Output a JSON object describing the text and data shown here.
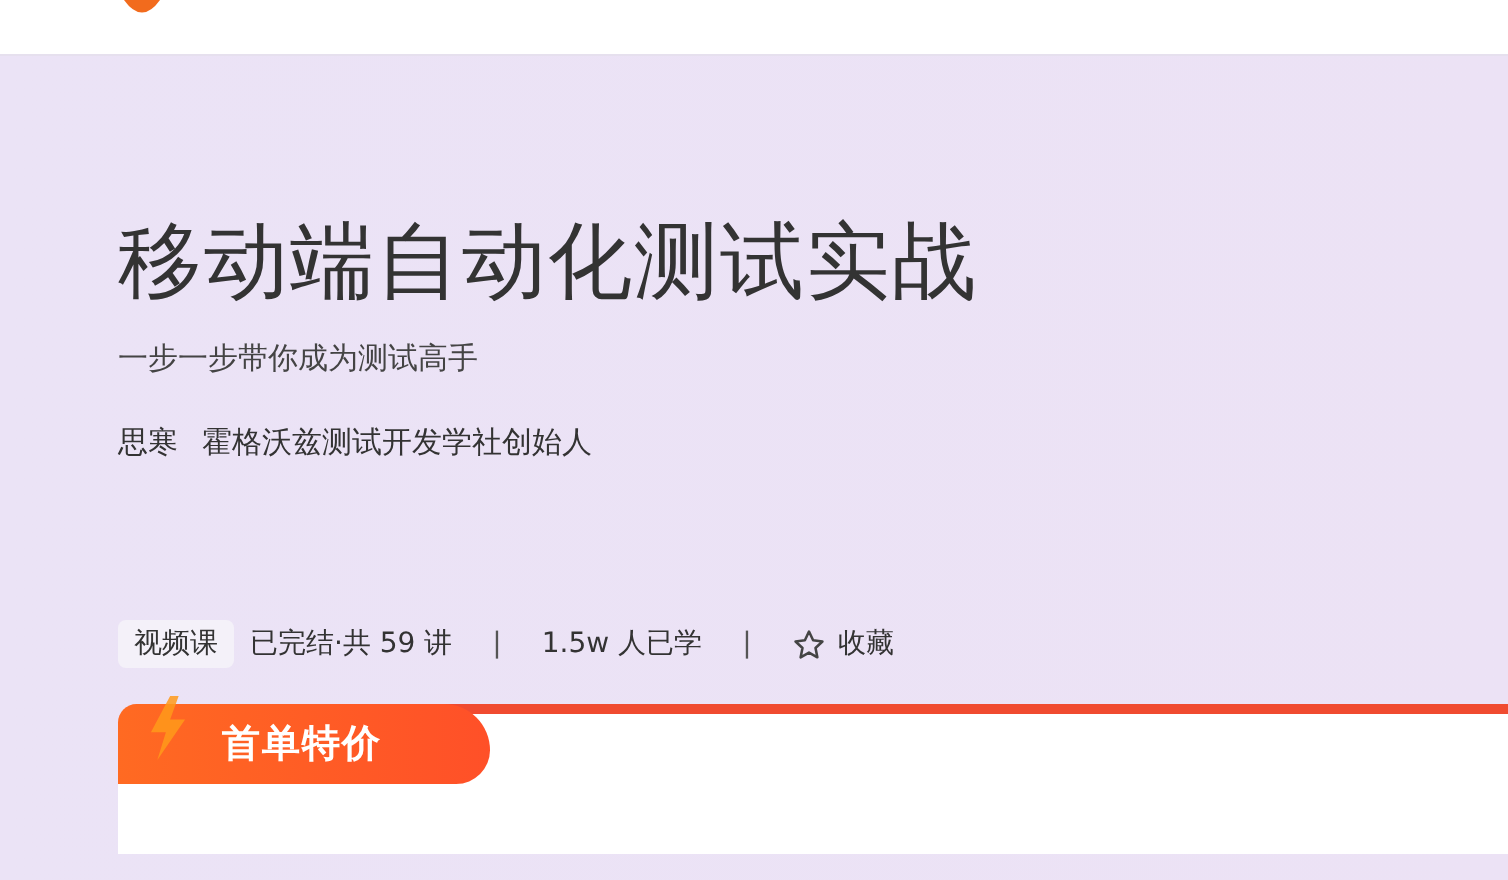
{
  "course": {
    "title": "移动端自动化测试实战",
    "subtitle": "一步一步带你成为测试高手",
    "author": "思寒",
    "author_title": "霍格沃兹测试开发学社创始人"
  },
  "meta": {
    "type_tag": "视频课",
    "progress": "已完结·共 59 讲",
    "separator_1": "|",
    "learners": "1.5w 人已学",
    "separator_2": "|",
    "favorite": {
      "label": "收藏",
      "selected": false
    }
  },
  "promo": {
    "label": "首单特价"
  }
}
